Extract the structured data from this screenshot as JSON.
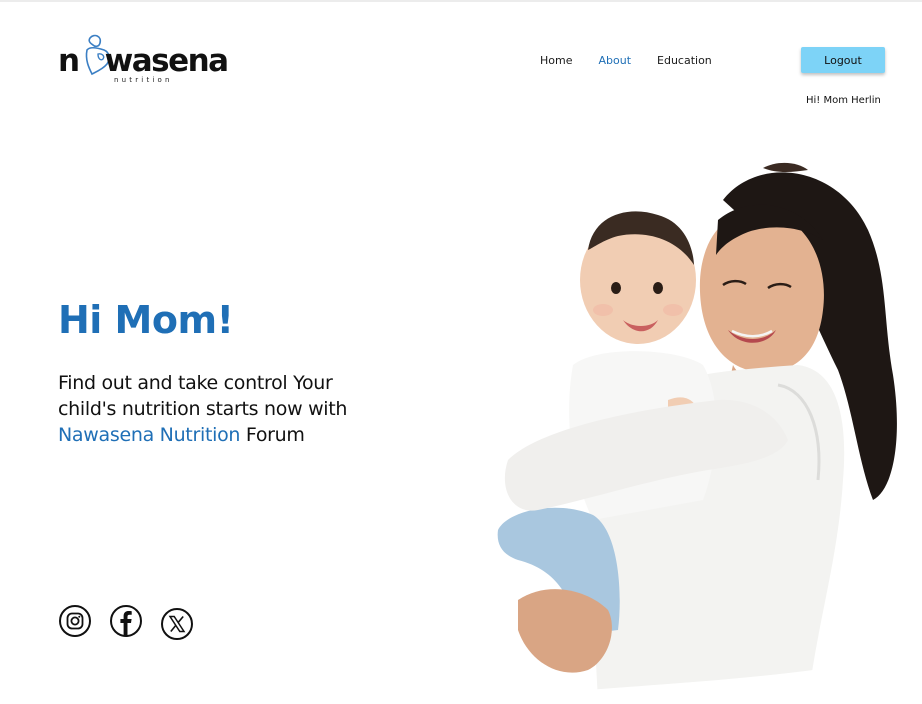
{
  "logo": {
    "brand": "n wasena",
    "part1": "n",
    "part2": "wasena",
    "tagline": "nutrition"
  },
  "nav": {
    "items": [
      "Home",
      "About",
      "Education"
    ],
    "active": "About"
  },
  "header": {
    "logout_label": "Logout",
    "greeting": "Hi! Mom Herlin"
  },
  "hero": {
    "title": "Hi Mom!",
    "text_part1": "Find out and take control Your child's nutrition starts now with ",
    "brand_highlight": "Nawasena Nutrition",
    "text_part2": " Forum"
  },
  "social": {
    "icons": [
      "instagram-icon",
      "facebook-icon",
      "x-icon"
    ]
  },
  "colors": {
    "accent": "#1f6fb6",
    "button": "#7dd3f7"
  }
}
